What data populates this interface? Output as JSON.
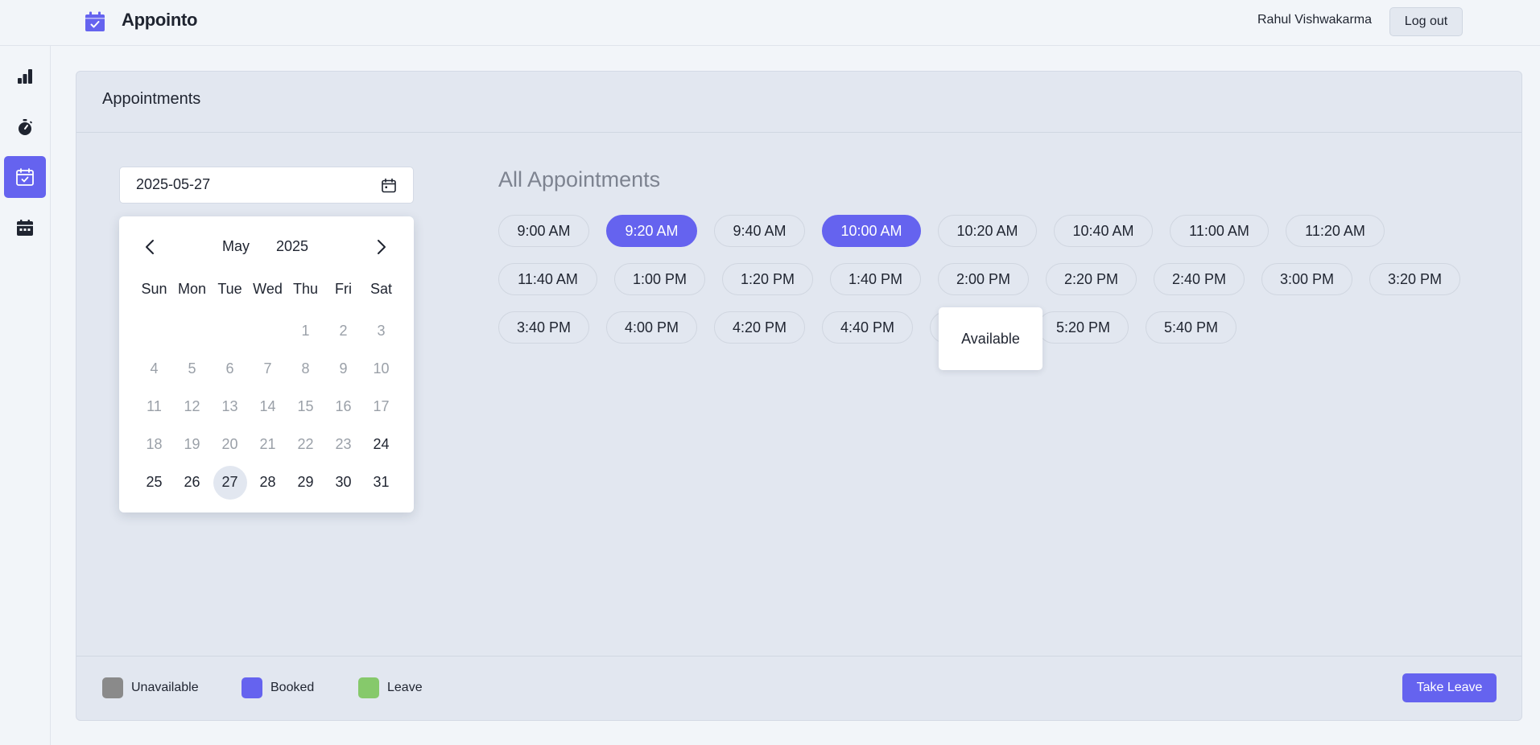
{
  "app": {
    "name": "Appointo"
  },
  "header": {
    "user_name": "Rahul Vishwakarma",
    "logout_label": "Log out"
  },
  "sidebar": {
    "items": [
      {
        "icon": "bar-chart-icon",
        "active": false
      },
      {
        "icon": "stopwatch-icon",
        "active": false
      },
      {
        "icon": "calendar-check-icon",
        "active": true
      },
      {
        "icon": "calendar-icon",
        "active": false
      }
    ]
  },
  "panel": {
    "title": "Appointments"
  },
  "date_input": {
    "value": "2025-05-27"
  },
  "calendar": {
    "month": "May",
    "year": "2025",
    "weekdays": [
      "Sun",
      "Mon",
      "Tue",
      "Wed",
      "Thu",
      "Fri",
      "Sat"
    ],
    "leading_blanks": 4,
    "days": [
      {
        "d": "1",
        "s": "disabled"
      },
      {
        "d": "2",
        "s": "disabled"
      },
      {
        "d": "3",
        "s": "disabled"
      },
      {
        "d": "4",
        "s": "disabled"
      },
      {
        "d": "5",
        "s": "disabled"
      },
      {
        "d": "6",
        "s": "disabled"
      },
      {
        "d": "7",
        "s": "disabled"
      },
      {
        "d": "8",
        "s": "disabled"
      },
      {
        "d": "9",
        "s": "disabled"
      },
      {
        "d": "10",
        "s": "disabled"
      },
      {
        "d": "11",
        "s": "disabled"
      },
      {
        "d": "12",
        "s": "disabled"
      },
      {
        "d": "13",
        "s": "disabled"
      },
      {
        "d": "14",
        "s": "disabled"
      },
      {
        "d": "15",
        "s": "disabled"
      },
      {
        "d": "16",
        "s": "disabled"
      },
      {
        "d": "17",
        "s": "disabled"
      },
      {
        "d": "18",
        "s": "disabled"
      },
      {
        "d": "19",
        "s": "disabled"
      },
      {
        "d": "20",
        "s": "disabled"
      },
      {
        "d": "21",
        "s": "disabled"
      },
      {
        "d": "22",
        "s": "disabled"
      },
      {
        "d": "23",
        "s": "disabled"
      },
      {
        "d": "24",
        "s": "enabled"
      },
      {
        "d": "25",
        "s": "enabled"
      },
      {
        "d": "26",
        "s": "enabled"
      },
      {
        "d": "27",
        "s": "selected"
      },
      {
        "d": "28",
        "s": "enabled"
      },
      {
        "d": "29",
        "s": "enabled"
      },
      {
        "d": "30",
        "s": "enabled"
      },
      {
        "d": "31",
        "s": "enabled"
      }
    ]
  },
  "appointments": {
    "title": "All Appointments",
    "rows": [
      [
        {
          "time": "9:00 AM",
          "status": "unavailable"
        },
        {
          "time": "9:20 AM",
          "status": "booked"
        },
        {
          "time": "9:40 AM",
          "status": "unavailable"
        },
        {
          "time": "10:00 AM",
          "status": "booked"
        },
        {
          "time": "10:20 AM",
          "status": "unavailable"
        },
        {
          "time": "10:40 AM",
          "status": "unavailable"
        },
        {
          "time": "11:00 AM",
          "status": "unavailable"
        },
        {
          "time": "11:20 AM",
          "status": "unavailable"
        }
      ],
      [
        {
          "time": "11:40 AM",
          "status": "unavailable"
        },
        {
          "time": "1:00 PM",
          "status": "unavailable"
        },
        {
          "time": "1:20 PM",
          "status": "unavailable"
        },
        {
          "time": "1:40 PM",
          "status": "unavailable"
        },
        {
          "time": "2:00 PM",
          "status": "unavailable"
        },
        {
          "time": "2:20 PM",
          "status": "unavailable"
        },
        {
          "time": "2:40 PM",
          "status": "unavailable"
        },
        {
          "time": "3:00 PM",
          "status": "unavailable"
        },
        {
          "time": "3:20 PM",
          "status": "unavailable"
        }
      ],
      [
        {
          "time": "3:40 PM",
          "status": "unavailable"
        },
        {
          "time": "4:00 PM",
          "status": "unavailable"
        },
        {
          "time": "4:20 PM",
          "status": "unavailable"
        },
        {
          "time": "4:40 PM",
          "status": "unavailable"
        },
        {
          "time": "5:00 PM",
          "status": "unavailable"
        },
        {
          "time": "5:20 PM",
          "status": "unavailable"
        },
        {
          "time": "5:40 PM",
          "status": "unavailable"
        }
      ]
    ],
    "tooltip": "Available"
  },
  "legend": [
    {
      "label": "Unavailable",
      "color": "#8a8a8a"
    },
    {
      "label": "Booked",
      "color": "#6563ef"
    },
    {
      "label": "Leave",
      "color": "#86c96b"
    }
  ],
  "footer": {
    "take_leave_label": "Take Leave"
  },
  "colors": {
    "accent": "#6563ef",
    "panel": "#e2e7f0",
    "background": "#f2f5f9"
  }
}
